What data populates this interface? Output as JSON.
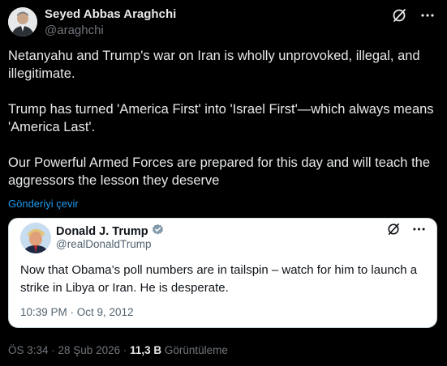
{
  "author": {
    "name": "Seyed Abbas Araghchi",
    "handle": "@araghchi"
  },
  "tweet": {
    "paragraphs": [
      "Netanyahu and Trump's war on Iran is wholly unprovoked, illegal, and illegitimate.",
      "Trump has turned 'America First' into 'Israel First'—which always means 'America Last'.",
      "Our Powerful Armed Forces are prepared for this day and will teach the aggressors the lesson they deserve"
    ],
    "translate_label": "Gönderiyi çevir"
  },
  "quoted": {
    "name": "Donald J. Trump",
    "handle": "@realDonaldTrump",
    "text": "Now that Obama’s poll numbers are in tailspin – watch for him to launch a strike in Libya or Iran.  He is desperate.",
    "timestamp": "10:39 PM · Oct 9, 2012"
  },
  "meta": {
    "time": "ÖS 3:34 · 28 Şub 2026 · ",
    "views": "11,3 B",
    "views_label": " Görüntüleme"
  },
  "icons": [
    "grok-icon",
    "more-icon",
    "verified-badge-icon"
  ],
  "colors": {
    "background": "#000000",
    "link": "#1d9bf0",
    "verified": "#829aab"
  }
}
